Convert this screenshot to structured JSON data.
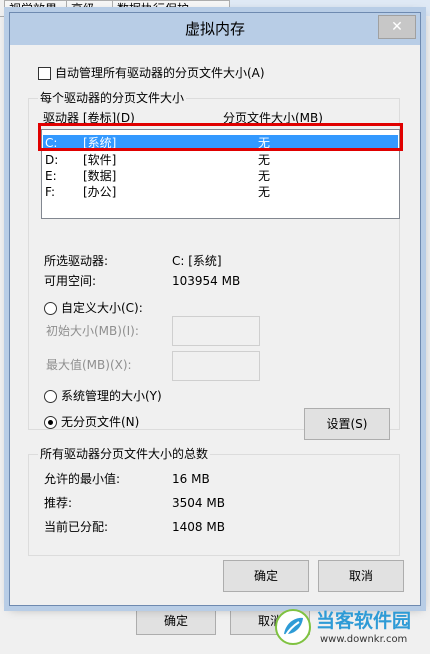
{
  "background": {
    "tabs": [
      "视觉效果",
      "高级",
      "数据执行保护"
    ],
    "ok_label": "确定",
    "cancel_label": "取消"
  },
  "dialog": {
    "title": "虚拟内存",
    "close_symbol": "✕",
    "auto_manage_label": "自动管理所有驱动器的分页文件大小(A)",
    "auto_manage_checked": false,
    "per_drive_group_label": "每个驱动器的分页文件大小",
    "list_headers": {
      "drive": "驱动器 [卷标](D)",
      "size": "分页文件大小(MB)"
    },
    "drives": [
      {
        "letter": "C:",
        "label": "[系统]",
        "size": "无",
        "selected": true
      },
      {
        "letter": "D:",
        "label": "[软件]",
        "size": "无",
        "selected": false
      },
      {
        "letter": "E:",
        "label": "[数据]",
        "size": "无",
        "selected": false
      },
      {
        "letter": "F:",
        "label": "[办公]",
        "size": "无",
        "selected": false
      }
    ],
    "selected_drive_label": "所选驱动器:",
    "selected_drive_value": "C:  [系统]",
    "free_space_label": "可用空间:",
    "free_space_value": "103954 MB",
    "custom_size_label": "自定义大小(C):",
    "initial_size_label": "初始大小(MB)(I):",
    "max_size_label": "最大值(MB)(X):",
    "system_managed_label": "系统管理的大小(Y)",
    "no_paging_label": "无分页文件(N)",
    "selected_option": "no_paging",
    "set_button": "设置(S)",
    "totals_group_label": "所有驱动器分页文件大小的总数",
    "min_allowed_label": "允许的最小值:",
    "min_allowed_value": "16 MB",
    "recommended_label": "推荐:",
    "recommended_value": "3504 MB",
    "current_label": "当前已分配:",
    "current_value": "1408 MB",
    "ok_button": "确定",
    "cancel_button": "取消"
  },
  "watermark": {
    "brand": "当客软件园",
    "url": "www.downkr.com"
  },
  "colors": {
    "highlight": "#3399ff",
    "annotation": "#e00000",
    "frame": "#b8cde6"
  }
}
